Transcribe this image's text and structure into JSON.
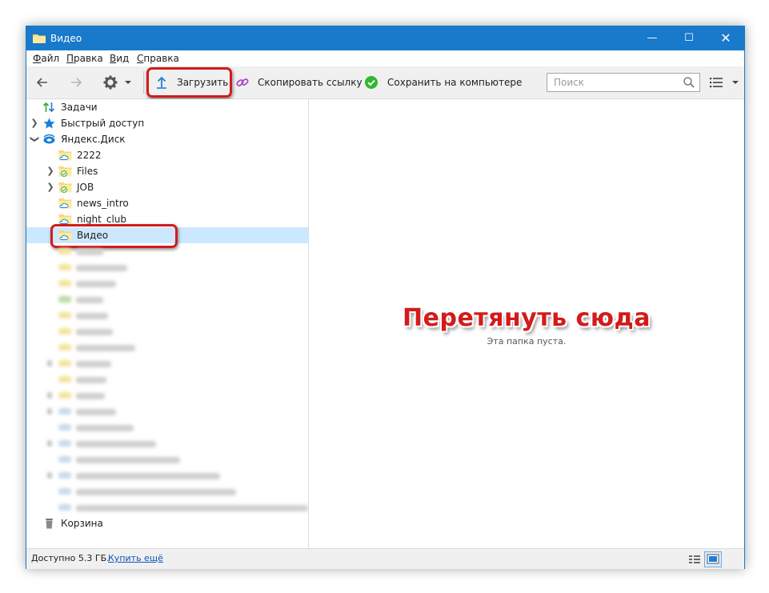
{
  "window": {
    "title": "Видео"
  },
  "menu": [
    {
      "accel": "Ф",
      "rest": "айл"
    },
    {
      "accel": "П",
      "rest": "равка"
    },
    {
      "accel": "В",
      "rest": "ид"
    },
    {
      "accel": "С",
      "rest": "правка"
    }
  ],
  "toolbar": {
    "upload_label": "Загрузить",
    "copy_link_label": "Скопировать ссылку",
    "save_label": "Сохранить на компьютере"
  },
  "search": {
    "placeholder": "Поиск"
  },
  "tree": {
    "tasks": "Задачи",
    "quick_access": "Быстрый доступ",
    "yadisk": "Яндекс.Диск",
    "folders": [
      "2222",
      "Files",
      "JOB",
      "news_intro",
      "night_club",
      "Видео"
    ],
    "trash": "Корзина"
  },
  "content": {
    "drop_hint": "Перетянуть сюда",
    "empty_message": "Эта папка пуста."
  },
  "status": {
    "available": "Доступно 5.3 ГБ.",
    "buy_link": "Купить ещё"
  },
  "colors": {
    "accent": "#1979ca",
    "highlight": "#d31b1b",
    "selection": "#cce8ff"
  }
}
